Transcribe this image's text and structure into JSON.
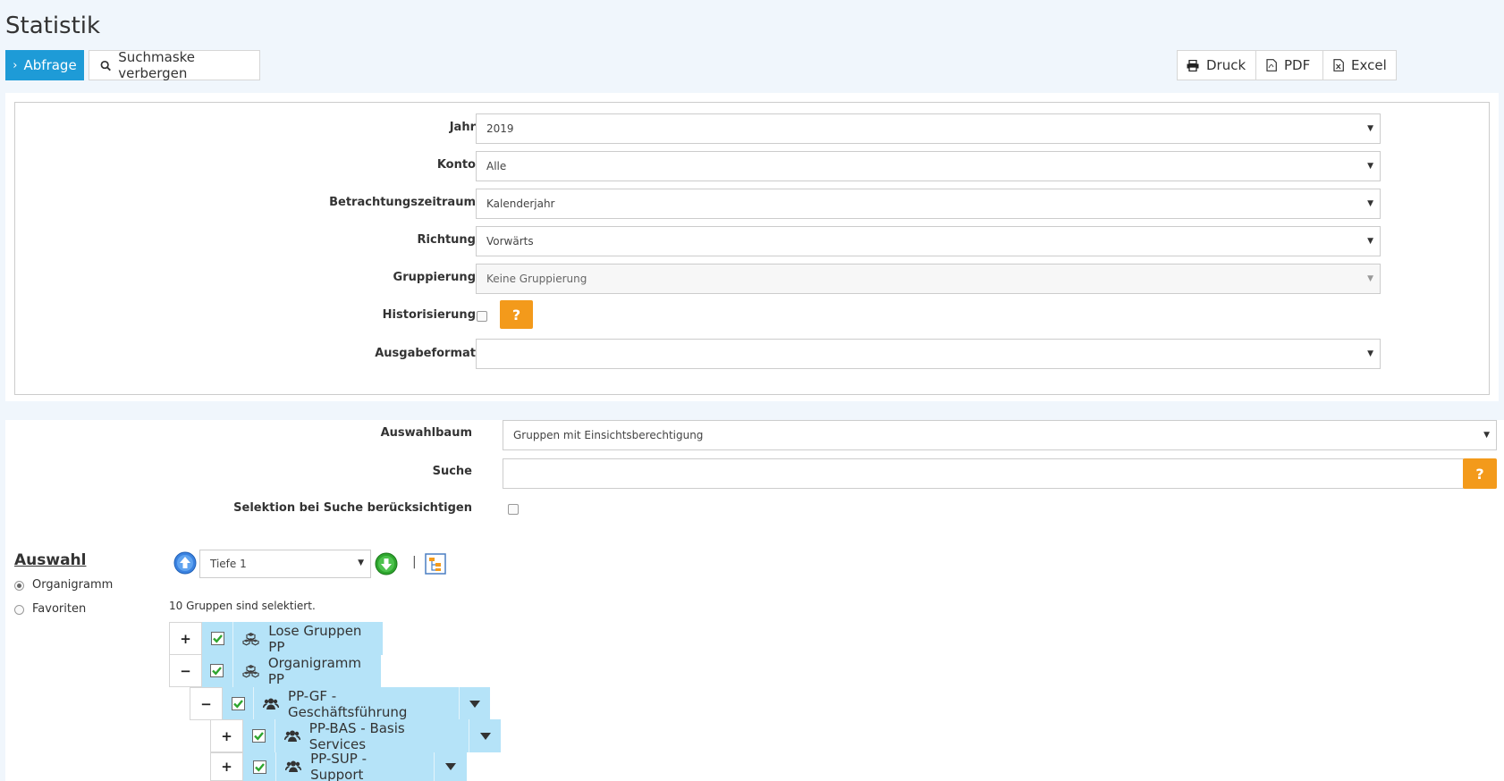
{
  "page_title": "Statistik",
  "toolbar": {
    "query_label": "Abfrage",
    "hide_search_label": "Suchmaske verbergen",
    "print_label": "Druck",
    "pdf_label": "PDF",
    "excel_label": "Excel"
  },
  "form": {
    "jahr": {
      "label": "Jahr",
      "value": "2019"
    },
    "konto": {
      "label": "Konto",
      "value": "Alle"
    },
    "zeitraum": {
      "label": "Betrachtungszeitraum",
      "value": "Kalenderjahr"
    },
    "richtung": {
      "label": "Richtung",
      "value": "Vorwärts"
    },
    "gruppierung": {
      "label": "Gruppierung",
      "value": "Keine Gruppierung"
    },
    "historisierung": {
      "label": "Historisierung",
      "help": "?"
    },
    "ausgabeformat": {
      "label": "Ausgabeformat",
      "value": ""
    }
  },
  "selection": {
    "auswahlbaum": {
      "label": "Auswahlbaum",
      "value": "Gruppen mit Einsichtsberechtigung"
    },
    "suche": {
      "label": "Suche",
      "value": "",
      "help": "?"
    },
    "selektion_label": "Selektion bei Suche berücksichtigen"
  },
  "auswahl": {
    "heading": "Auswahl",
    "options": [
      "Organigramm",
      "Favoriten"
    ],
    "selected": "Organigramm"
  },
  "tree": {
    "depth_value": "Tiefe 1",
    "separator": "|",
    "status": "10 Gruppen sind selektiert.",
    "nodes": [
      {
        "toggle": "+",
        "label": "Lose Gruppen PP",
        "icon": "cubes-icon",
        "checked": true
      },
      {
        "toggle": "−",
        "label": "Organigramm PP",
        "icon": "cubes-icon",
        "checked": true
      },
      {
        "toggle": "−",
        "label": "PP-GF - Geschäftsführung",
        "icon": "users-icon",
        "checked": true
      },
      {
        "toggle": "+",
        "label": "PP-BAS - Basis Services",
        "icon": "users-icon",
        "checked": true
      },
      {
        "toggle": "+",
        "label": "PP-SUP - Support",
        "icon": "users-icon",
        "checked": true
      }
    ]
  },
  "colors": {
    "primary": "#1e9bd7",
    "help": "#f39a1b",
    "node_bg": "#b5e3f8"
  }
}
